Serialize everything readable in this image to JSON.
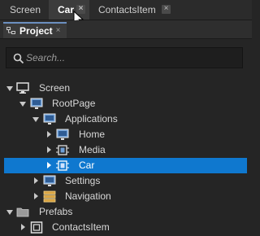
{
  "tabs": [
    {
      "label": "Screen"
    },
    {
      "label": "Car"
    },
    {
      "label": "ContactsItem"
    }
  ],
  "panel": {
    "title": "Project"
  },
  "search": {
    "placeholder": "Search..."
  },
  "tree": [
    {
      "label": "Screen",
      "icon": "monitor-icon",
      "expanded": true
    },
    {
      "label": "RootPage",
      "icon": "page-icon",
      "expanded": true
    },
    {
      "label": "Applications",
      "icon": "page-icon",
      "expanded": true
    },
    {
      "label": "Home",
      "icon": "page-icon",
      "expanded": false
    },
    {
      "label": "Media",
      "icon": "component-icon",
      "expanded": false
    },
    {
      "label": "Car",
      "icon": "component-icon",
      "expanded": false,
      "selected": true
    },
    {
      "label": "Settings",
      "icon": "page-icon",
      "expanded": false
    },
    {
      "label": "Navigation",
      "icon": "stack-icon",
      "expanded": false
    },
    {
      "label": "Prefabs",
      "icon": "folder-icon",
      "expanded": true
    },
    {
      "label": "ContactsItem",
      "icon": "node-icon",
      "expanded": false
    }
  ],
  "colors": {
    "selection": "#0f78cf",
    "background": "#252525"
  }
}
